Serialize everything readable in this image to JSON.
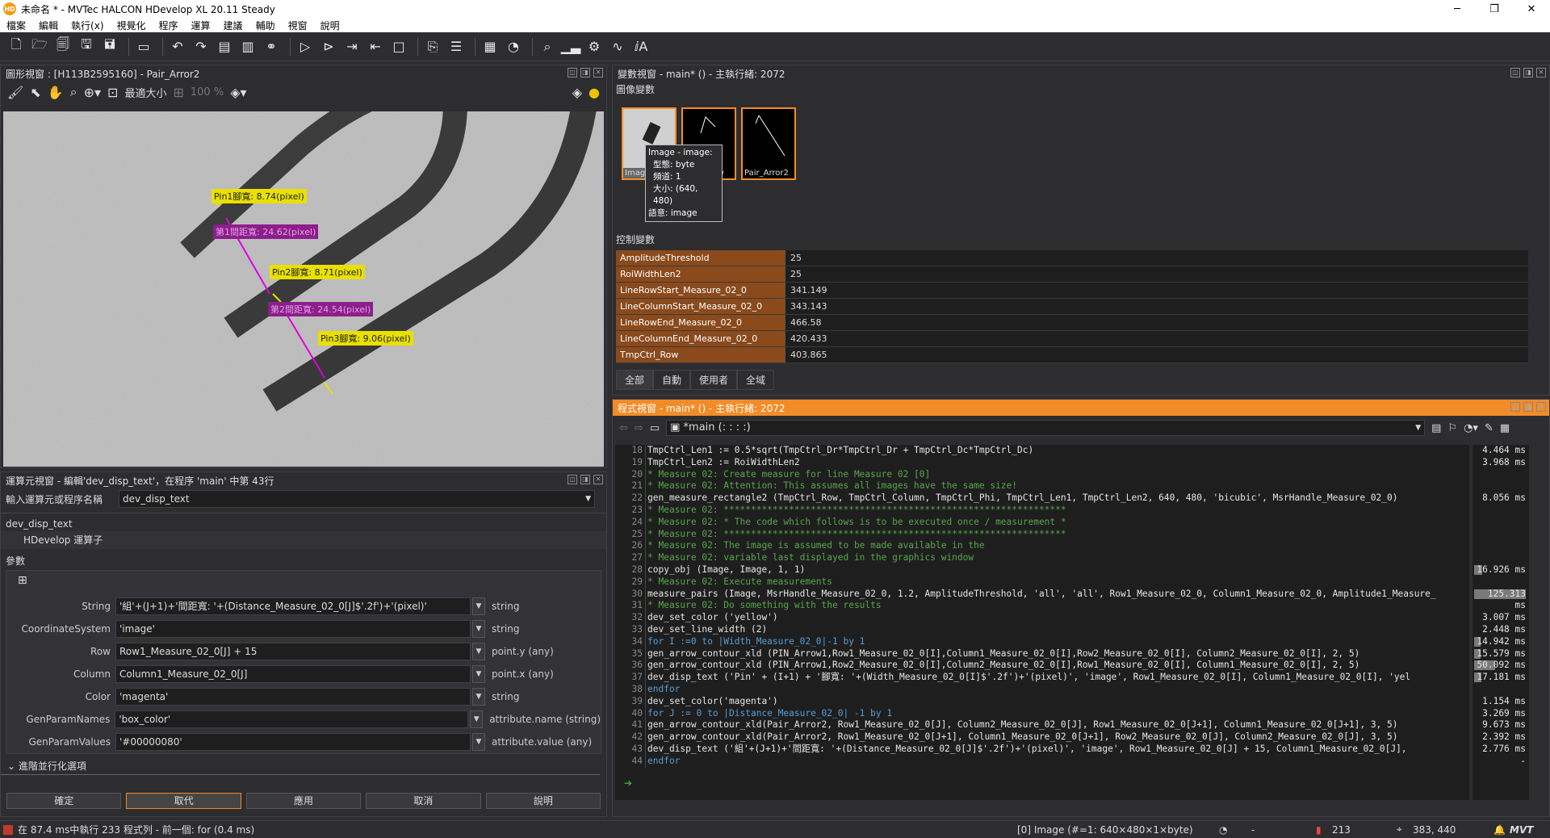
{
  "window": {
    "title": "未命名 * - MVTec HALCON HDevelop XL 20.11 Steady",
    "logo": "HD"
  },
  "menu": [
    "檔案",
    "編輯",
    "執行(x)",
    "視覺化",
    "程序",
    "運算",
    "建議",
    "輔助",
    "視窗",
    "說明"
  ],
  "graphics": {
    "title": "圖形視窗 : [H113B2595160] - Pair_Arror2",
    "zoom_mode": "最適大小",
    "zoom_pct": "100 %",
    "annotations": [
      {
        "text": "Pin1腳寬: 8.74(pixel)",
        "kind": "y"
      },
      {
        "text": "第1間距寬: 24.62(pixel)",
        "kind": "m"
      },
      {
        "text": "Pin2腳寬: 8.71(pixel)",
        "kind": "y"
      },
      {
        "text": "第2間距寬: 24.54(pixel)",
        "kind": "m"
      },
      {
        "text": "Pin3腳寬: 9.06(pixel)",
        "kind": "y"
      }
    ]
  },
  "operator": {
    "title": "運算元視窗 - 編輯'dev_disp_text'，在程序 'main' 中第 43行",
    "input_label": "輸入運算元或程序名稱",
    "input_value": "dev_disp_text",
    "op_name": "dev_disp_text",
    "op_category": "HDevelop 運算子",
    "params_label": "參數",
    "params": [
      {
        "name": "String",
        "value": "'組'+(J+1)+'間距寬: '+(Distance_Measure_02_0[J]$'.2f')+'(pixel)'",
        "type": "string"
      },
      {
        "name": "CoordinateSystem",
        "value": "'image'",
        "type": "string"
      },
      {
        "name": "Row",
        "value": "Row1_Measure_02_0[J] + 15",
        "type": "point.y (any)"
      },
      {
        "name": "Column",
        "value": "Column1_Measure_02_0[J]",
        "type": "point.x (any)"
      },
      {
        "name": "Color",
        "value": "'magenta'",
        "type": "string"
      },
      {
        "name": "GenParamNames",
        "value": "'box_color'",
        "type": "attribute.name (string)"
      },
      {
        "name": "GenParamValues",
        "value": "'#00000080'",
        "type": "attribute.value (any)"
      }
    ],
    "advanced": "進階並行化選項",
    "buttons": [
      "確定",
      "取代",
      "應用",
      "取消",
      "說明"
    ]
  },
  "variables": {
    "title": "變數視窗 - main* () - 主執行緒: 2072",
    "image_vars_label": "圖像變數",
    "thumbs": [
      "Image",
      "Pin_Arrow",
      "Pair_Arror2"
    ],
    "tooltip": [
      "Image - image:",
      "型態: byte",
      "頻道: 1",
      "大小: (640, 480)",
      "語意: image"
    ],
    "ctrl_label": "控制變數",
    "ctrl": [
      {
        "name": "AmplitudeThreshold",
        "value": "25"
      },
      {
        "name": "RoiWidthLen2",
        "value": "25"
      },
      {
        "name": "LineRowStart_Measure_02_0",
        "value": "341.149"
      },
      {
        "name": "LineColumnStart_Measure_02_0",
        "value": "343.143"
      },
      {
        "name": "LineRowEnd_Measure_02_0",
        "value": "466.58"
      },
      {
        "name": "LineColumnEnd_Measure_02_0",
        "value": "420.433"
      },
      {
        "name": "TmpCtrl_Row",
        "value": "403.865"
      }
    ],
    "tabs": [
      "全部",
      "自動",
      "使用者",
      "全域"
    ]
  },
  "program": {
    "title": "程式視窗 - main* () - 主執行緒: 2072",
    "proc": "*main (: : : :)",
    "lines": [
      {
        "n": "18",
        "t": "TmpCtrl_Len1 := 0.5*sqrt(TmpCtrl_Dr*TmpCtrl_Dr + TmpCtrl_Dc*TmpCtrl_Dc)",
        "s": "",
        "time": "4.464 ms",
        "b": 0
      },
      {
        "n": "19",
        "t": "TmpCtrl_Len2 := RoiWidthLen2",
        "s": "",
        "time": "3.968 ms",
        "b": 0
      },
      {
        "n": "20",
        "t": "* Measure 02: Create measure for line Measure 02 [0]",
        "s": "c",
        "time": "",
        "b": 0
      },
      {
        "n": "21",
        "t": "* Measure 02: Attention: This assumes all images have the same size!",
        "s": "c",
        "time": "",
        "b": 0
      },
      {
        "n": "22",
        "t": "gen_measure_rectangle2 (TmpCtrl_Row, TmpCtrl_Column, TmpCtrl_Phi, TmpCtrl_Len1, TmpCtrl_Len2, 640, 480, 'bicubic', MsrHandle_Measure_02_0)",
        "s": "",
        "time": "8.056 ms",
        "b": 0
      },
      {
        "n": "23",
        "t": "* Measure 02: ***************************************************************",
        "s": "c",
        "time": "",
        "b": 0
      },
      {
        "n": "24",
        "t": "* Measure 02: * The code which follows is to be executed once / measurement *",
        "s": "c",
        "time": "",
        "b": 0
      },
      {
        "n": "25",
        "t": "* Measure 02: ***************************************************************",
        "s": "c",
        "time": "",
        "b": 0
      },
      {
        "n": "26",
        "t": "* Measure 02: The image is assumed to be made available in the",
        "s": "c",
        "time": "",
        "b": 0
      },
      {
        "n": "27",
        "t": "* Measure 02: variable last displayed in the graphics window",
        "s": "c",
        "time": "",
        "b": 0
      },
      {
        "n": "28",
        "t": "copy_obj (Image, Image, 1, 1)",
        "s": "",
        "time": "16.926 ms",
        "b": 0.15
      },
      {
        "n": "29",
        "t": "* Measure 02: Execute measurements",
        "s": "c",
        "time": "",
        "b": 0
      },
      {
        "n": "30",
        "t": "measure_pairs (Image, MsrHandle_Measure_02_0, 1.2, AmplitudeThreshold, 'all', 'all', Row1_Measure_02_0, Column1_Measure_02_0, Amplitude1_Measure_",
        "s": "",
        "time": "125.313 ms",
        "b": 1
      },
      {
        "n": "31",
        "t": "* Measure 02: Do something with the results",
        "s": "c",
        "time": "",
        "b": 0
      },
      {
        "n": "32",
        "t": "dev_set_color ('yellow')",
        "s": "",
        "time": "3.007 ms",
        "b": 0
      },
      {
        "n": "33",
        "t": "dev_set_line_width (2)",
        "s": "",
        "time": "2.448 ms",
        "b": 0
      },
      {
        "n": "34",
        "t": "for I :=0 to |Width_Measure_02_0|-1 by 1",
        "s": "k",
        "time": "14.942 ms",
        "b": 0.12
      },
      {
        "n": "35",
        "t": "    gen_arrow_contour_xld (PIN_Arrow1,Row1_Measure_02_0[I],Column1_Measure_02_0[I],Row2_Measure_02_0[I], Column2_Measure_02_0[I], 2, 5)",
        "s": "",
        "time": "15.579 ms",
        "b": 0.12
      },
      {
        "n": "36",
        "t": "    gen_arrow_contour_xld (PIN_Arrow1,Row2_Measure_02_0[I],Column2_Measure_02_0[I],Row1_Measure_02_0[I], Column1_Measure_02_0[I], 2, 5)",
        "s": "",
        "time": "50.092 ms",
        "b": 0.4
      },
      {
        "n": "37",
        "t": "    dev_disp_text ('Pin' + (I+1) + '腳寬: '+(Width_Measure_02_0[I]$'.2f')+'(pixel)', 'image', Row1_Measure_02_0[I], Column1_Measure_02_0[I], 'yel",
        "s": "",
        "time": "17.181 ms",
        "b": 0.14
      },
      {
        "n": "38",
        "t": "endfor",
        "s": "k",
        "time": "",
        "b": 0
      },
      {
        "n": "39",
        "t": "dev_set_color('magenta')",
        "s": "",
        "time": "1.154 ms",
        "b": 0
      },
      {
        "n": "40",
        "t": "for J := 0 to |Distance_Measure_02_0| -1 by 1",
        "s": "k",
        "time": "3.269 ms",
        "b": 0
      },
      {
        "n": "41",
        "t": "    gen_arrow_contour_xld(Pair_Arror2, Row1_Measure_02_0[J], Column2_Measure_02_0[J], Row1_Measure_02_0[J+1], Column1_Measure_02_0[J+1], 3, 5)",
        "s": "",
        "time": "9.673 ms",
        "b": 0
      },
      {
        "n": "42",
        "t": "    gen_arrow_contour_xld(Pair_Arror2, Row1_Measure_02_0[J+1], Column1_Measure_02_0[J+1], Row2_Measure_02_0[J], Column2_Measure_02_0[J], 3, 5)",
        "s": "",
        "time": "2.392 ms",
        "b": 0
      },
      {
        "n": "43",
        "t": "    dev_disp_text ('組'+(J+1)+'間距寬: '+(Distance_Measure_02_0[J]$'.2f')+'(pixel)', 'image', Row1_Measure_02_0[J] + 15, Column1_Measure_02_0[J],",
        "s": "",
        "time": "2.776 ms",
        "b": 0
      },
      {
        "n": "44",
        "t": "endfor",
        "s": "k",
        "time": "-",
        "b": 0
      }
    ]
  },
  "status": {
    "left": "在 87.4 ms中執行 233 程式列 - 前一個: for (0.4 ms)",
    "image_info": "[0] Image (#=1: 640×480×1×byte)",
    "time": "-",
    "gray": "213",
    "coords": "383, 440",
    "brand": "MVT"
  }
}
